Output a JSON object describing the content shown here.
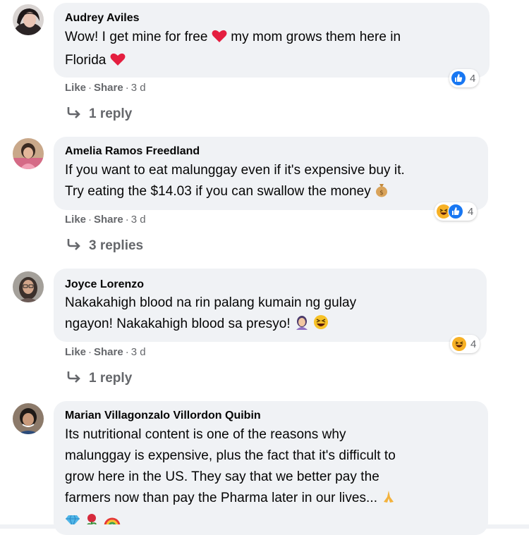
{
  "actions": {
    "like": "Like",
    "share": "Share",
    "sep": "·"
  },
  "comments": [
    {
      "author": "Audrey Aviles",
      "text_a": "Wow! I get mine for free",
      "text_b": "my mom grows them here in",
      "text_c": "Florida",
      "time": "3 d",
      "reaction_count": "4",
      "replies": "1 reply"
    },
    {
      "author": "Amelia Ramos Freedland",
      "line1": "If you want to eat malunggay even if it's expensive buy it.",
      "line2": "Try eating the $14.03 if you can swallow the money",
      "time": "3 d",
      "reaction_count": "4",
      "replies": "3 replies"
    },
    {
      "author": "Joyce Lorenzo",
      "line1": "Nakakahigh blood na rin palang kumain ng gulay",
      "line2": "ngayon! Nakakahigh blood sa presyo!",
      "time": "3 d",
      "reaction_count": "4",
      "replies": "1 reply"
    },
    {
      "author": "Marian Villagonzalo Villordon Quibin",
      "line1": "Its nutritional content is one of the reasons why",
      "line2": "malunggay is expensive, plus the fact that it's difficult to",
      "line3": "grow here in the US. They say that we better pay the",
      "line4": "farmers now than pay the Pharma later in our lives..."
    }
  ],
  "colors": {
    "bubble": "#f0f2f5",
    "secondary_text": "#65676b",
    "like_blue": "#1877f2",
    "heart_red": "#e41e3f"
  },
  "icons": [
    "heart-emoji",
    "money-bag-emoji",
    "woman-facepalming-emoji",
    "grinning-squinting-emoji",
    "folded-hands-emoji",
    "gem-emoji",
    "rose-emoji",
    "rainbow-emoji",
    "like-reaction-icon",
    "haha-reaction-icon",
    "reply-arrow-icon"
  ]
}
